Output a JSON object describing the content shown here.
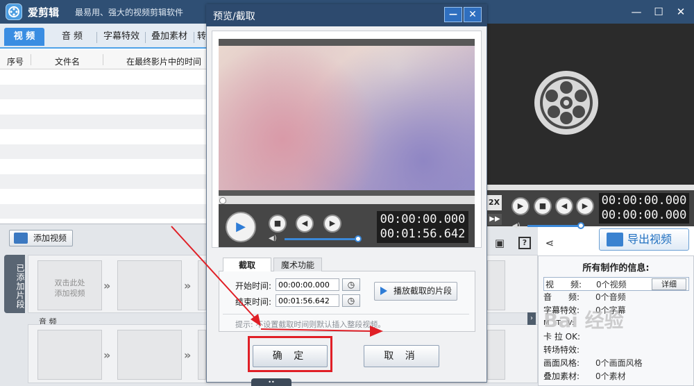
{
  "app": {
    "name": "爱剪辑",
    "slogan": "最易用、强大的视频剪辑软件",
    "win_min": "—",
    "win_max": "☐",
    "win_close": "✕"
  },
  "tabs": [
    {
      "label": "视 频",
      "active": true
    },
    {
      "label": "音 频"
    },
    {
      "label": "字幕特效"
    },
    {
      "label": "叠加素材"
    },
    {
      "label": "转"
    }
  ],
  "list": {
    "headers": [
      "序号",
      "文件名",
      "在最终影片中的时间"
    ]
  },
  "bottom": {
    "add_video": "添加视频",
    "added_clips": "已添加片段",
    "empty_clip": [
      "双击此处",
      "添加视频"
    ],
    "audio_label": "音 频"
  },
  "right": {
    "speed": "2X",
    "time_current": "00:00:00.000",
    "time_total": "00:00:00.000",
    "export": "导出视频"
  },
  "info": {
    "title": "所有制作的信息:",
    "detail_button": "详细",
    "rows": [
      {
        "key": "视　　频:",
        "value": "0个视频"
      },
      {
        "key": "音　　频:",
        "value": "0个音频"
      },
      {
        "key": "字幕特效:",
        "value": "0个字幕"
      },
      {
        "key": "M　T　V:",
        "value": ""
      },
      {
        "key": "卡 拉 OK:",
        "value": ""
      },
      {
        "key": "转场特效:",
        "value": ""
      },
      {
        "key": "画面风格:",
        "value": "0个画面风格"
      },
      {
        "key": "叠加素材:",
        "value": "0个素材"
      }
    ]
  },
  "dialog": {
    "title": "预览/截取",
    "min": "—",
    "close": "✕",
    "time_current": "00:00:00.000",
    "time_total": "00:01:56.642",
    "subtabs": [
      "截取",
      "魔术功能"
    ],
    "start_label": "开始时间:",
    "start_value": "00:00:00.000",
    "end_label": "结束时间:",
    "end_value": "00:01:56.642",
    "play_segment": "播放截取的片段",
    "hint": "提示: 不设置截取时间则默认插入整段视频。",
    "ok": "确 定",
    "cancel": "取 消"
  },
  "watermark": "Bai 经验",
  "colors": {
    "titlebar": "#2f4f74",
    "accent": "#3a8de2",
    "highlight": "#e01f26"
  }
}
